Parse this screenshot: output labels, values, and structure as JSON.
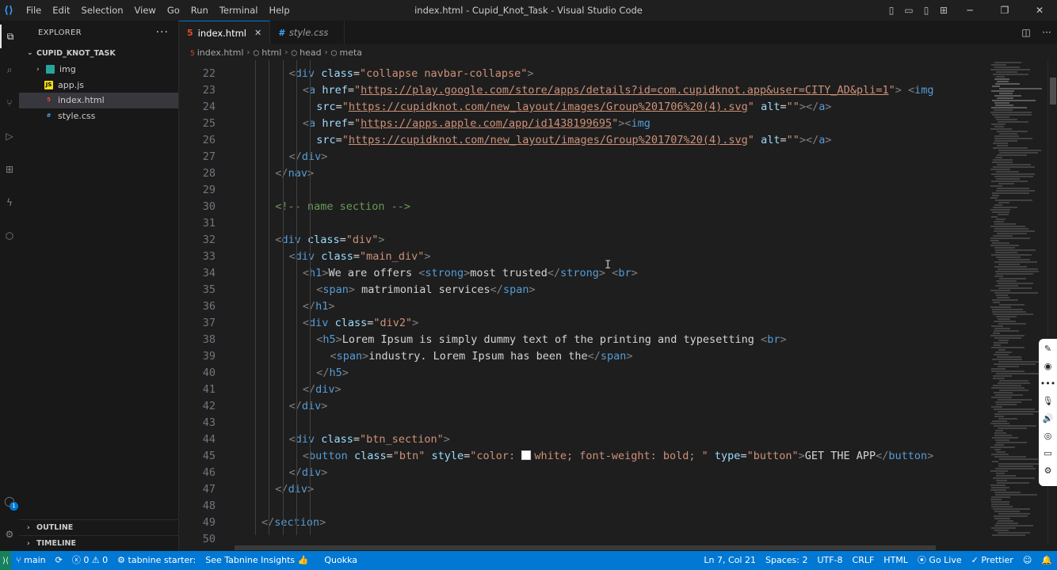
{
  "window": {
    "title": "index.html - Cupid_Knot_Task - Visual Studio Code",
    "menu": [
      "File",
      "Edit",
      "Selection",
      "View",
      "Go",
      "Run",
      "Terminal",
      "Help"
    ]
  },
  "activity_bar": [
    {
      "name": "explorer-icon",
      "glyph": "⧉"
    },
    {
      "name": "search-icon",
      "glyph": "⌕"
    },
    {
      "name": "source-control-icon",
      "glyph": "⑂"
    },
    {
      "name": "run-debug-icon",
      "glyph": "▷"
    },
    {
      "name": "extensions-icon",
      "glyph": "⊞"
    },
    {
      "name": "tabnine-icon",
      "glyph": "ϟ"
    },
    {
      "name": "remote-explorer-icon",
      "glyph": "⬡"
    }
  ],
  "account_badge": "1",
  "sidebar": {
    "header": "EXPLORER",
    "folder": "CUPID_KNOT_TASK",
    "items": [
      {
        "label": "img",
        "type": "folder",
        "icon_color": "#26a69a"
      },
      {
        "label": "app.js",
        "type": "js",
        "icon_color": "#f5de19"
      },
      {
        "label": "index.html",
        "type": "html",
        "icon_color": "#e44d26",
        "selected": true
      },
      {
        "label": "style.css",
        "type": "css",
        "icon_color": "#42a5f5"
      }
    ],
    "outline": "OUTLINE",
    "timeline": "TIMELINE"
  },
  "tabs": [
    {
      "label": "index.html",
      "active": true,
      "icon": "html-file-icon",
      "icon_color": "#e44d26"
    },
    {
      "label": "style.css",
      "active": false,
      "icon": "css-file-icon",
      "icon_color": "#42a5f5"
    }
  ],
  "breadcrumb": [
    "index.html",
    "html",
    "head",
    "meta"
  ],
  "code_lines": [
    {
      "n": "22",
      "html": "<span class=\"tg\">&lt;</span><span class=\"tn\">div</span> <span class=\"at\">class</span><span class=\"tx\">=</span><span class=\"st\">\"collapse navbar-collapse\"</span><span class=\"tg\">&gt;</span>",
      "indent": 2
    },
    {
      "n": "23",
      "html": "<span class=\"tg\">&lt;</span><span class=\"tn\">a</span> <span class=\"at\">href</span><span class=\"tx\">=</span><span class=\"st\">\"</span><span class=\"lk\">https://play.google.com/store/apps/details?id=com.cupidknot.app&amp;user=CITY_AD&amp;pli=1</span><span class=\"st\">\"</span><span class=\"tg\">&gt;</span> <span class=\"tg\">&lt;</span><span class=\"tn\">img</span>",
      "indent": 3
    },
    {
      "n": "24",
      "html": "<span class=\"at\">src</span><span class=\"tx\">=</span><span class=\"st\">\"</span><span class=\"lk\">https://cupidknot.com/new_layout/images/Group%201706%20(4).svg</span><span class=\"st\">\"</span> <span class=\"at\">alt</span><span class=\"tx\">=</span><span class=\"st\">\"\"</span><span class=\"tg\">&gt;&lt;/</span><span class=\"tn\">a</span><span class=\"tg\">&gt;</span>",
      "indent": 4
    },
    {
      "n": "25",
      "html": "<span class=\"tg\">&lt;</span><span class=\"tn\">a</span> <span class=\"at\">href</span><span class=\"tx\">=</span><span class=\"st\">\"</span><span class=\"lk\">https://apps.apple.com/app/id1438199695</span><span class=\"st\">\"</span><span class=\"tg\">&gt;&lt;</span><span class=\"tn\">img</span>",
      "indent": 3
    },
    {
      "n": "26",
      "html": "<span class=\"at\">src</span><span class=\"tx\">=</span><span class=\"st\">\"</span><span class=\"lk\">https://cupidknot.com/new_layout/images/Group%201707%20(4).svg</span><span class=\"st\">\"</span> <span class=\"at\">alt</span><span class=\"tx\">=</span><span class=\"st\">\"\"</span><span class=\"tg\">&gt;&lt;/</span><span class=\"tn\">a</span><span class=\"tg\">&gt;</span>",
      "indent": 4
    },
    {
      "n": "27",
      "html": "<span class=\"tg\">&lt;/</span><span class=\"tn\">div</span><span class=\"tg\">&gt;</span>",
      "indent": 2
    },
    {
      "n": "28",
      "html": "<span class=\"tg\">&lt;/</span><span class=\"tn\">nav</span><span class=\"tg\">&gt;</span>",
      "indent": 1
    },
    {
      "n": "29",
      "html": "",
      "indent": 0
    },
    {
      "n": "30",
      "html": "<span class=\"cm\">&lt;!-- name section --&gt;</span>",
      "indent": 1
    },
    {
      "n": "31",
      "html": "",
      "indent": 0
    },
    {
      "n": "32",
      "html": "<span class=\"tg\">&lt;</span><span class=\"tn\">div</span> <span class=\"at\">class</span><span class=\"tx\">=</span><span class=\"st\">\"div\"</span><span class=\"tg\">&gt;</span>",
      "indent": 1
    },
    {
      "n": "33",
      "html": "<span class=\"tg\">&lt;</span><span class=\"tn\">div</span> <span class=\"at\">class</span><span class=\"tx\">=</span><span class=\"st\">\"main_div\"</span><span class=\"tg\">&gt;</span>",
      "indent": 2
    },
    {
      "n": "34",
      "html": "<span class=\"tg\">&lt;</span><span class=\"tn\">h1</span><span class=\"tg\">&gt;</span><span class=\"tx\">We are offers </span><span class=\"tg\">&lt;</span><span class=\"tn\">strong</span><span class=\"tg\">&gt;</span><span class=\"tx\">most trusted</span><span class=\"tg\">&lt;/</span><span class=\"tn\">strong</span><span class=\"tg\">&gt;</span> <span class=\"tg\">&lt;</span><span class=\"tn\">br</span><span class=\"tg\">&gt;</span>",
      "indent": 3
    },
    {
      "n": "35",
      "html": "<span class=\"tg\">&lt;</span><span class=\"tn\">span</span><span class=\"tg\">&gt;</span><span class=\"tx\"> matrimonial services</span><span class=\"tg\">&lt;/</span><span class=\"tn\">span</span><span class=\"tg\">&gt;</span>",
      "indent": 4
    },
    {
      "n": "36",
      "html": "<span class=\"tg\">&lt;/</span><span class=\"tn\">h1</span><span class=\"tg\">&gt;</span>",
      "indent": 3
    },
    {
      "n": "37",
      "html": "<span class=\"tg\">&lt;</span><span class=\"tn\">div</span> <span class=\"at\">class</span><span class=\"tx\">=</span><span class=\"st\">\"div2\"</span><span class=\"tg\">&gt;</span>",
      "indent": 3
    },
    {
      "n": "38",
      "html": "<span class=\"tg\">&lt;</span><span class=\"tn\">h5</span><span class=\"tg\">&gt;</span><span class=\"tx\">Lorem Ipsum is simply dummy text of the printing and typesetting </span><span class=\"tg\">&lt;</span><span class=\"tn\">br</span><span class=\"tg\">&gt;</span>",
      "indent": 4
    },
    {
      "n": "39",
      "html": "<span class=\"tg\">&lt;</span><span class=\"tn\">span</span><span class=\"tg\">&gt;</span><span class=\"tx\">industry. Lorem Ipsum has been the</span><span class=\"tg\">&lt;/</span><span class=\"tn\">span</span><span class=\"tg\">&gt;</span>",
      "indent": 5
    },
    {
      "n": "40",
      "html": "<span class=\"tg\">&lt;/</span><span class=\"tn\">h5</span><span class=\"tg\">&gt;</span>",
      "indent": 4
    },
    {
      "n": "41",
      "html": "<span class=\"tg\">&lt;/</span><span class=\"tn\">div</span><span class=\"tg\">&gt;</span>",
      "indent": 3
    },
    {
      "n": "42",
      "html": "<span class=\"tg\">&lt;/</span><span class=\"tn\">div</span><span class=\"tg\">&gt;</span>",
      "indent": 2
    },
    {
      "n": "43",
      "html": "",
      "indent": 0
    },
    {
      "n": "44",
      "html": "<span class=\"tg\">&lt;</span><span class=\"tn\">div</span> <span class=\"at\">class</span><span class=\"tx\">=</span><span class=\"st\">\"btn_section\"</span><span class=\"tg\">&gt;</span>",
      "indent": 2
    },
    {
      "n": "45",
      "html": "<span class=\"tg\">&lt;</span><span class=\"tn\">button</span> <span class=\"at\">class</span><span class=\"tx\">=</span><span class=\"st\">\"btn\"</span> <span class=\"at\">style</span><span class=\"tx\">=</span><span class=\"st\">\"color: <span class=\"swatch\"></span>white; font-weight: bold; \"</span> <span class=\"at\">type</span><span class=\"tx\">=</span><span class=\"st\">\"button\"</span><span class=\"tg\">&gt;</span><span class=\"tx\">GET THE APP</span><span class=\"tg\">&lt;/</span><span class=\"tn\">button</span><span class=\"tg\">&gt;</span>",
      "indent": 3
    },
    {
      "n": "46",
      "html": "<span class=\"tg\">&lt;/</span><span class=\"tn\">div</span><span class=\"tg\">&gt;</span>",
      "indent": 2
    },
    {
      "n": "47",
      "html": "<span class=\"tg\">&lt;/</span><span class=\"tn\">div</span><span class=\"tg\">&gt;</span>",
      "indent": 1
    },
    {
      "n": "48",
      "html": "",
      "indent": 0
    },
    {
      "n": "49",
      "html": "<span class=\"tg\">&lt;/</span><span class=\"tn\">section</span><span class=\"tg\">&gt;</span>",
      "indent": 0
    },
    {
      "n": "50",
      "html": "",
      "indent": 0
    }
  ],
  "statusbar": {
    "branch": "main",
    "errors": "0",
    "warnings": "0",
    "tabnine": "tabnine starter:",
    "tabnine_insights": "See Tabnine Insights 👍",
    "quokka": "Quokka",
    "position": "Ln 7, Col 21",
    "spaces": "Spaces: 2",
    "encoding": "UTF-8",
    "eol": "CRLF",
    "language": "HTML",
    "golive": "Go Live",
    "prettier": "Prettier"
  },
  "colors": {
    "statusbar": "#0078d4",
    "editor_bg": "#1e1e1e",
    "sidebar_bg": "#181818"
  }
}
